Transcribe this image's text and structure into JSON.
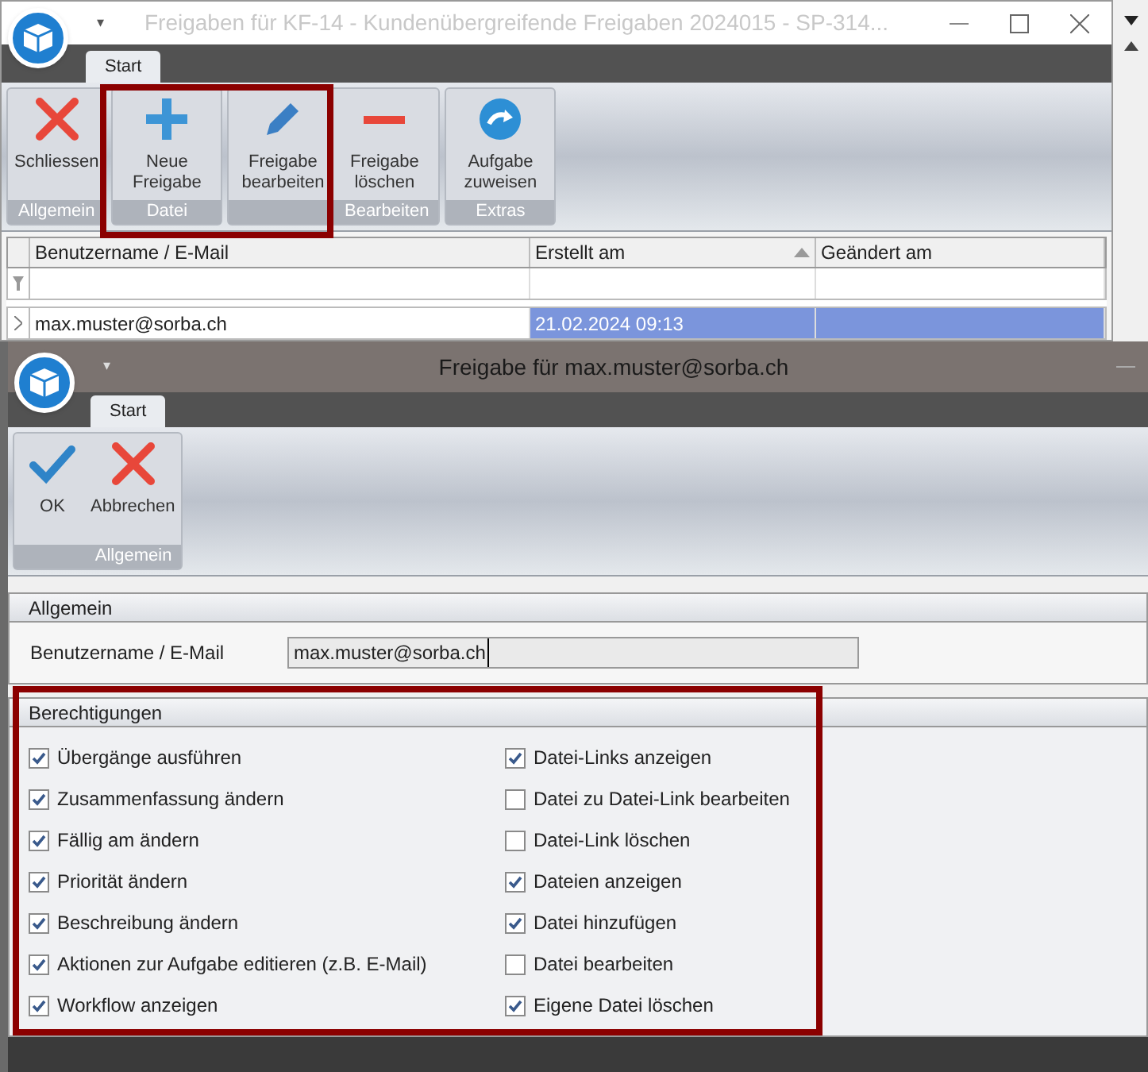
{
  "background_window": {
    "quick_access": "▾",
    "title": "Freigaben für KF-14 - Kundenübergreifende Freigaben 2024015 - SP-314...",
    "tabs": [
      {
        "label": "Start",
        "selected": true
      }
    ],
    "ribbon_groups": [
      {
        "label": "Allgemein",
        "buttons": [
          {
            "label": "Schliessen",
            "kind": "close"
          }
        ]
      },
      {
        "label": "Datei",
        "buttons": [
          {
            "label": "Neue Freigabe",
            "kind": "add"
          }
        ]
      },
      {
        "label": "Bearbeiten",
        "buttons": [
          {
            "label": "Freigabe bearbeiten",
            "kind": "edit"
          },
          {
            "label": "Freigabe löschen",
            "kind": "remove"
          }
        ]
      },
      {
        "label": "Extras",
        "buttons": [
          {
            "label": "Aufgabe zuweisen",
            "kind": "assign"
          }
        ]
      }
    ],
    "table": {
      "columns": [
        {
          "label": "Benutzername / E-Mail",
          "sorted": false
        },
        {
          "label": "Erstellt am",
          "sorted": true
        },
        {
          "label": "Geändert am",
          "sorted": false
        }
      ],
      "rows": [
        {
          "selected": true,
          "cells": [
            "max.muster@sorba.ch",
            "21.02.2024 09:13",
            ""
          ]
        }
      ]
    }
  },
  "dialog": {
    "quick_access": "▾",
    "title": "Freigabe für max.muster@sorba.ch",
    "tabs": [
      {
        "label": "Start",
        "selected": true
      }
    ],
    "ribbon_groups": [
      {
        "label": "Allgemein",
        "buttons": [
          {
            "label": "OK",
            "kind": "ok"
          },
          {
            "label": "Abbrechen",
            "kind": "close"
          }
        ]
      }
    ],
    "general": {
      "heading": "Allgemein",
      "field_label": "Benutzername / E-Mail",
      "field_value": "max.muster@sorba.ch"
    },
    "permissions": {
      "heading": "Berechtigungen",
      "columns": [
        [
          {
            "label": "Übergänge ausführen",
            "checked": true
          },
          {
            "label": "Zusammenfassung ändern",
            "checked": true
          },
          {
            "label": "Fällig am ändern",
            "checked": true
          },
          {
            "label": "Priorität ändern",
            "checked": true
          },
          {
            "label": "Beschreibung ändern",
            "checked": true
          },
          {
            "label": "Aktionen zur Aufgabe editieren (z.B. E-Mail)",
            "checked": true
          },
          {
            "label": "Workflow anzeigen",
            "checked": true
          }
        ],
        [
          {
            "label": "Datei-Links anzeigen",
            "checked": true
          },
          {
            "label": "Datei zu Datei-Link bearbeiten",
            "checked": false
          },
          {
            "label": "Datei-Link löschen",
            "checked": false
          },
          {
            "label": "Dateien anzeigen",
            "checked": true
          },
          {
            "label": "Datei hinzufügen",
            "checked": true
          },
          {
            "label": "Datei bearbeiten",
            "checked": false
          },
          {
            "label": "Eigene Datei löschen",
            "checked": true
          }
        ]
      ]
    }
  }
}
